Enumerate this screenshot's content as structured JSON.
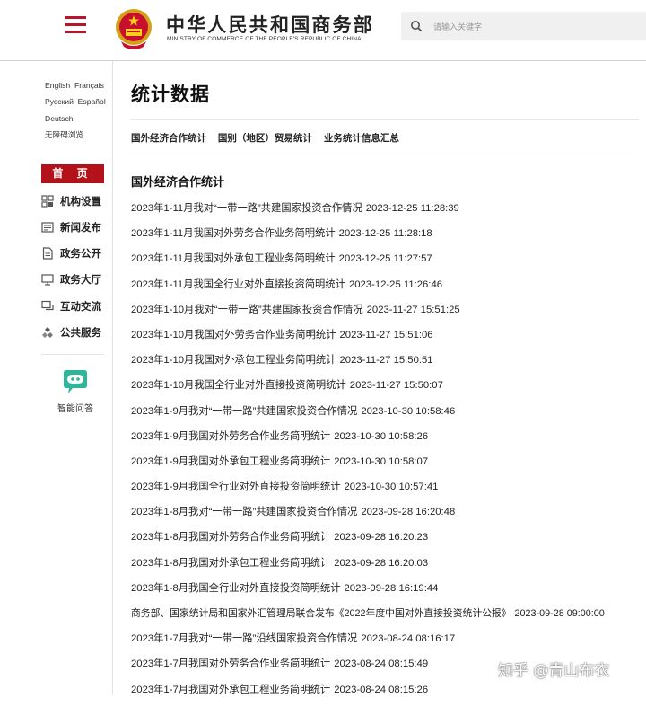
{
  "header": {
    "brand_cn": "中华人民共和国商务部",
    "brand_en": "MINISTRY OF COMMERCE OF THE PEOPLE'S REPUBLIC OF CHINA",
    "search_placeholder": "请输入关键字",
    "accent": "#b5162a"
  },
  "sidebar": {
    "lang_row1_a": "English",
    "lang_row1_b": "Français",
    "lang_row2_a": "Русский",
    "lang_row2_b": "Español",
    "lang_row3": "Deutsch",
    "lang_row4": "无障碍浏览",
    "home": "首 页",
    "nav": [
      {
        "label": "机构设置",
        "icon": "org-grid-icon"
      },
      {
        "label": "新闻发布",
        "icon": "news-icon"
      },
      {
        "label": "政务公开",
        "icon": "document-icon"
      },
      {
        "label": "政务大厅",
        "icon": "hall-icon"
      },
      {
        "label": "互动交流",
        "icon": "chat-icon"
      },
      {
        "label": "公共服务",
        "icon": "service-icon"
      }
    ],
    "assistant": "智能问答"
  },
  "main": {
    "title": "统计数据",
    "tabs": [
      "国外经济合作统计",
      "国别（地区）贸易统计",
      "业务统计信息汇总"
    ],
    "section": "国外经济合作统计",
    "items": [
      {
        "t": "2023年1-11月我对“一带一路”共建国家投资合作情况",
        "d": "2023-12-25 11:28:39"
      },
      {
        "t": "2023年1-11月我国对外劳务合作业务简明统计",
        "d": "2023-12-25 11:28:18"
      },
      {
        "t": "2023年1-11月我国对外承包工程业务简明统计",
        "d": "2023-12-25 11:27:57"
      },
      {
        "t": "2023年1-11月我国全行业对外直接投资简明统计",
        "d": "2023-12-25 11:26:46"
      },
      {
        "t": "2023年1-10月我对“一带一路”共建国家投资合作情况",
        "d": "2023-11-27 15:51:25"
      },
      {
        "t": "2023年1-10月我国对外劳务合作业务简明统计",
        "d": "2023-11-27 15:51:06"
      },
      {
        "t": "2023年1-10月我国对外承包工程业务简明统计",
        "d": "2023-11-27 15:50:51"
      },
      {
        "t": "2023年1-10月我国全行业对外直接投资简明统计",
        "d": "2023-11-27 15:50:07"
      },
      {
        "t": "2023年1-9月我对“一带一路”共建国家投资合作情况",
        "d": "2023-10-30 10:58:46"
      },
      {
        "t": "2023年1-9月我国对外劳务合作业务简明统计",
        "d": "2023-10-30 10:58:26"
      },
      {
        "t": "2023年1-9月我国对外承包工程业务简明统计",
        "d": "2023-10-30 10:58:07"
      },
      {
        "t": "2023年1-9月我国全行业对外直接投资简明统计",
        "d": "2023-10-30 10:57:41"
      },
      {
        "t": "2023年1-8月我对“一带一路”共建国家投资合作情况",
        "d": "2023-09-28 16:20:48"
      },
      {
        "t": "2023年1-8月我国对外劳务合作业务简明统计",
        "d": "2023-09-28 16:20:23"
      },
      {
        "t": "2023年1-8月我国对外承包工程业务简明统计",
        "d": "2023-09-28 16:20:03"
      },
      {
        "t": "2023年1-8月我国全行业对外直接投资简明统计",
        "d": "2023-09-28 16:19:44"
      },
      {
        "t": "商务部、国家统计局和国家外汇管理局联合发布《2022年度中国对外直接投资统计公报》",
        "d": "2023-09-28 09:00:00"
      },
      {
        "t": "2023年1-7月我对“一带一路”沿线国家投资合作情况",
        "d": "2023-08-24 08:16:17"
      },
      {
        "t": "2023年1-7月我国对外劳务合作业务简明统计",
        "d": "2023-08-24 08:15:49"
      },
      {
        "t": "2023年1-7月我国对外承包工程业务简明统计",
        "d": "2023-08-24 08:15:26"
      }
    ]
  },
  "watermark": "知乎 @青山布衣"
}
